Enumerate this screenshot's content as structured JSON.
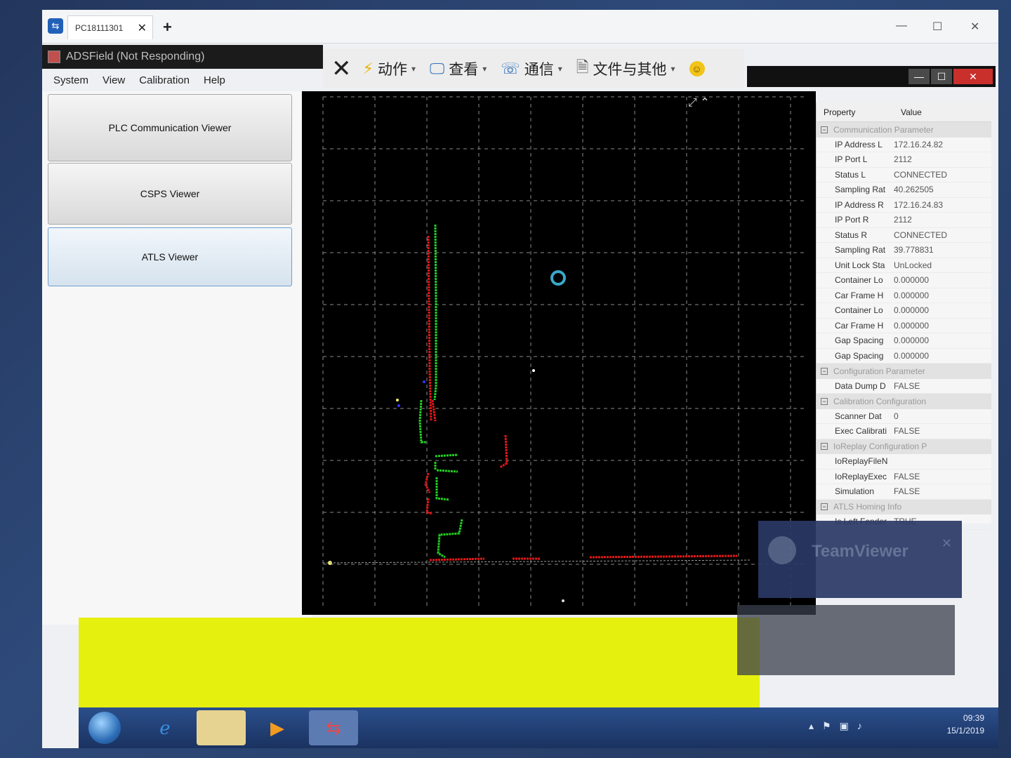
{
  "tabstrip": {
    "tab_label": "PC18111301",
    "close_glyph": "✕",
    "add_glyph": "+",
    "minimize_glyph": "—",
    "maximize_glyph": "☐",
    "close_window_glyph": "✕"
  },
  "app": {
    "title": "ADSField (Not Responding)",
    "menu": [
      "System",
      "View",
      "Calibration",
      "Help"
    ],
    "viewer_buttons": [
      "PLC Communication Viewer",
      "CSPS Viewer",
      "ATLS Viewer"
    ]
  },
  "tv_toolbar": {
    "close_glyph": "✕",
    "items": [
      {
        "label": "动作",
        "icon": "lightning-icon"
      },
      {
        "label": "查看",
        "icon": "monitor-icon"
      },
      {
        "label": "通信",
        "icon": "phone-icon"
      },
      {
        "label": "文件与其他",
        "icon": "file-icon"
      }
    ],
    "smiley_glyph": "☺"
  },
  "property_grid": {
    "header_property": "Property",
    "header_value": "Value",
    "categories": [
      {
        "name": "Communication Parameter",
        "rows": [
          {
            "k": "IP Address L",
            "v": "172.16.24.82"
          },
          {
            "k": "IP Port L",
            "v": "2112"
          },
          {
            "k": "Status L",
            "v": "CONNECTED"
          },
          {
            "k": "Sampling Rat",
            "v": "40.262505"
          },
          {
            "k": "IP Address R",
            "v": "172.16.24.83"
          },
          {
            "k": "IP Port R",
            "v": "2112"
          },
          {
            "k": "Status R",
            "v": "CONNECTED"
          },
          {
            "k": "Sampling Rat",
            "v": "39.778831"
          },
          {
            "k": "Unit Lock Sta",
            "v": "UnLocked"
          },
          {
            "k": "Container Lo",
            "v": "0.000000"
          },
          {
            "k": "Car Frame H",
            "v": "0.000000"
          },
          {
            "k": "Container Lo",
            "v": "0.000000"
          },
          {
            "k": "Car Frame H",
            "v": "0.000000"
          },
          {
            "k": "Gap Spacing",
            "v": "0.000000"
          },
          {
            "k": "Gap Spacing",
            "v": "0.000000"
          }
        ]
      },
      {
        "name": "Configuration Parameter",
        "rows": [
          {
            "k": "Data Dump D",
            "v": "FALSE"
          }
        ]
      },
      {
        "name": "Calibration Configuration",
        "rows": [
          {
            "k": "Scanner Dat",
            "v": "0"
          },
          {
            "k": "Exec Calibrati",
            "v": "FALSE"
          }
        ]
      },
      {
        "name": "IoReplay Configuration P",
        "rows": [
          {
            "k": "IoReplayFileN",
            "v": ""
          },
          {
            "k": "IoReplayExec",
            "v": "FALSE"
          },
          {
            "k": "Simulation",
            "v": "FALSE"
          }
        ]
      },
      {
        "name": "ATLS Homing Info",
        "rows": [
          {
            "k": "Is Left Fender",
            "v": "TRUE"
          }
        ]
      }
    ]
  },
  "teamviewer_panel": {
    "name": "TeamViewer",
    "close_glyph": "✕"
  },
  "taskbar": {
    "time": "09:39",
    "date": "15/1/2019"
  },
  "colors": {
    "plot_bg": "#000000",
    "grid": "#8a8a8a",
    "scan_red": "#e01818",
    "scan_green": "#22d022",
    "yellow_area": "#e6f00f"
  }
}
